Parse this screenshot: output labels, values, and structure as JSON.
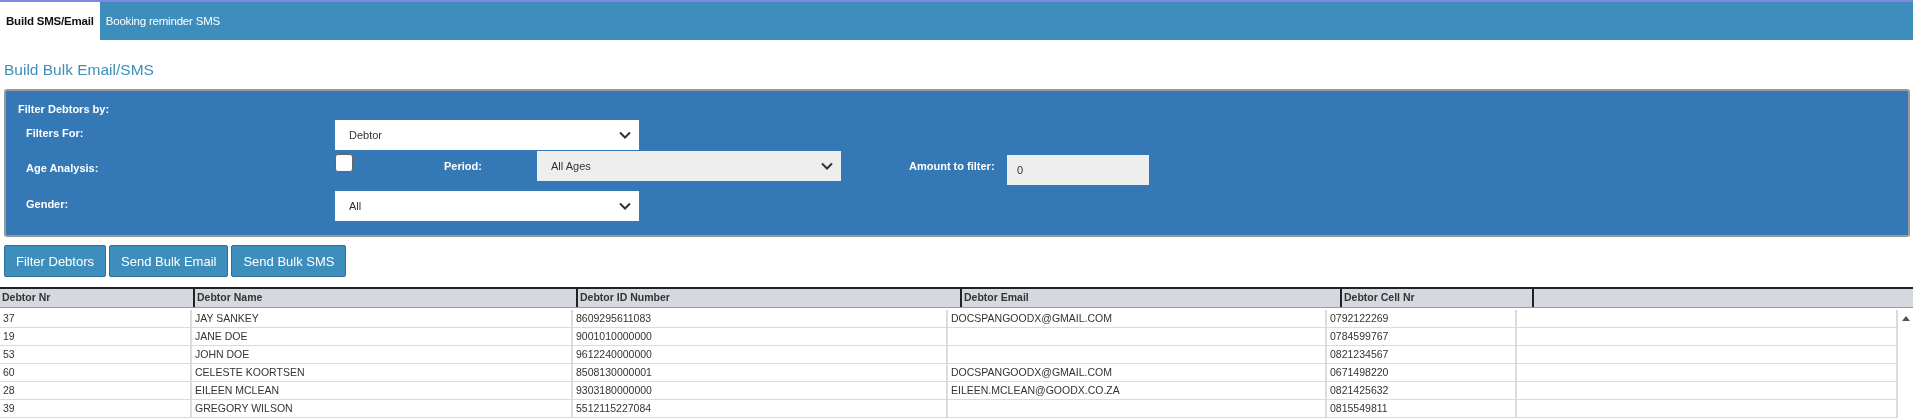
{
  "tabs": [
    {
      "label": "Build SMS/Email",
      "selected": true
    },
    {
      "label": "Booking reminder SMS",
      "selected": false
    }
  ],
  "heading": "Build Bulk Email/SMS",
  "filter_panel": {
    "title": "Filter Debtors by:",
    "filters_for": {
      "label": "Filters For:",
      "value": "Debtor"
    },
    "age_analysis": {
      "label": "Age Analysis:",
      "checked": false
    },
    "period": {
      "label": "Period:",
      "value": "All Ages"
    },
    "amount": {
      "label": "Amount to filter:",
      "value": "0"
    },
    "gender": {
      "label": "Gender:",
      "value": "All"
    }
  },
  "buttons": [
    "Filter Debtors",
    "Send Bulk Email",
    "Send Bulk SMS"
  ],
  "table": {
    "columns": [
      "Debtor Nr",
      "Debtor Name",
      "Debtor ID Number",
      "Debtor Email",
      "Debtor Cell Nr"
    ],
    "rows": [
      [
        "37",
        "JAY SANKEY",
        "8609295611083",
        "DOCSPANGOODX@GMAIL.COM",
        "0792122269"
      ],
      [
        "19",
        "JANE DOE",
        "9001010000000",
        "",
        "0784599767"
      ],
      [
        "53",
        "JOHN DOE",
        "9612240000000",
        "",
        "0821234567"
      ],
      [
        "60",
        "CELESTE KOORTSEN",
        "8508130000001",
        "DOCSPANGOODX@GMAIL.COM",
        "0671498220"
      ],
      [
        "28",
        "EILEEN MCLEAN",
        "9303180000000",
        "EILEEN.MCLEAN@GOODX.CO.ZA",
        "0821425632"
      ],
      [
        "39",
        "GREGORY WILSON",
        "5512115227084",
        "",
        "0815549811"
      ]
    ]
  }
}
